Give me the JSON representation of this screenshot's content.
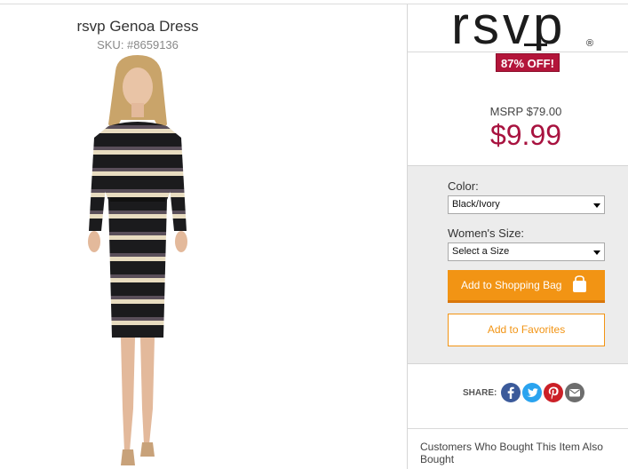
{
  "product": {
    "title": "rsvp Genoa Dress",
    "sku": "SKU: #8659136",
    "image_alt": "model wearing black and ivory striped belted dress"
  },
  "brand": {
    "logo_text": "rsvp",
    "registered_mark": "®"
  },
  "pricing": {
    "discount_badge": "87% OFF!",
    "msrp": "MSRP $79.00",
    "price": "$9.99"
  },
  "options": {
    "color_label": "Color:",
    "color_value": "Black/Ivory",
    "size_label": "Women's Size:",
    "size_value": "Select a Size"
  },
  "actions": {
    "add_to_bag": "Add to Shopping Bag",
    "add_to_favorites": "Add to Favorites"
  },
  "share": {
    "label": "SHARE:",
    "icons": [
      "facebook-icon",
      "twitter-icon",
      "pinterest-icon",
      "email-icon"
    ]
  },
  "recommendations": {
    "heading": "Customers Who Bought This Item Also Bought"
  },
  "colors": {
    "price_red": "#a8123f",
    "badge_red": "#b3153a",
    "accent_orange": "#f29414",
    "facebook_blue": "#3b5a9a",
    "twitter_blue": "#2aa3ef",
    "pinterest_red": "#cb2027",
    "email_gray": "#6d6d6d"
  }
}
